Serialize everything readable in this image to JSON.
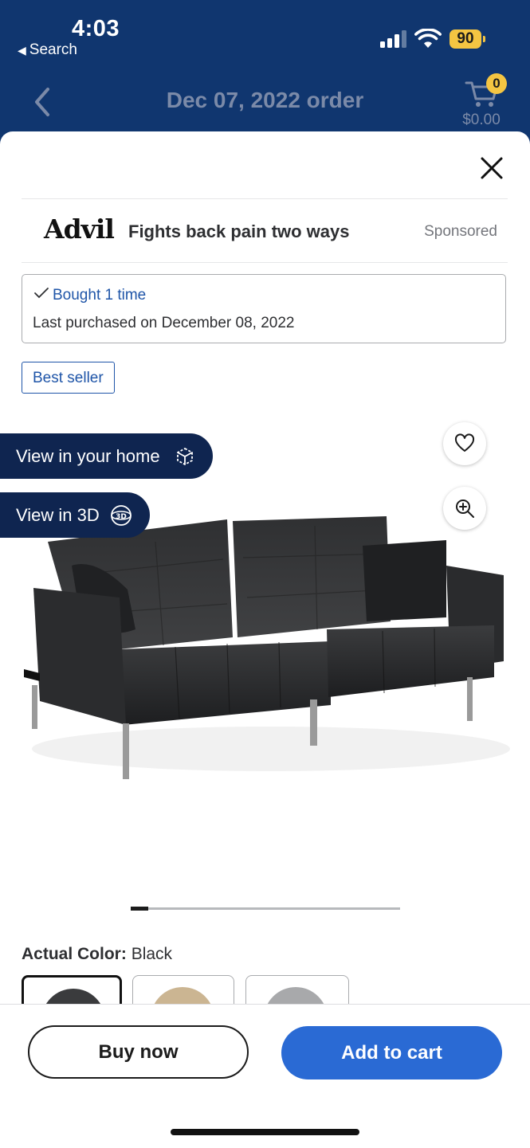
{
  "status_bar": {
    "time": "4:03",
    "back_label": "Search",
    "battery": "90"
  },
  "nav": {
    "title": "Dec 07, 2022 order",
    "cart_count": "0",
    "cart_total": "$0.00"
  },
  "ad": {
    "brand": "Advil",
    "headline": "Fights back pain two ways",
    "sponsored_label": "Sponsored"
  },
  "purchase_history": {
    "bought_label": "Bought 1 time",
    "last_purchased": "Last purchased on December 08, 2022"
  },
  "badges": {
    "best_seller": "Best seller"
  },
  "viewer": {
    "view_in_home": "View in your home",
    "view_in_3d": "View in 3D",
    "carousel_position": 1
  },
  "variant": {
    "label": "Actual Color:",
    "selected": "Black",
    "swatch_colors": [
      "#3a3b3d",
      "#cbb592",
      "#a8a9ab"
    ]
  },
  "actions": {
    "buy_now": "Buy now",
    "add_to_cart": "Add to cart"
  },
  "colors": {
    "header_bg": "#10366f",
    "accent_blue": "#2a6ad4",
    "badge_yellow": "#f4c542"
  }
}
